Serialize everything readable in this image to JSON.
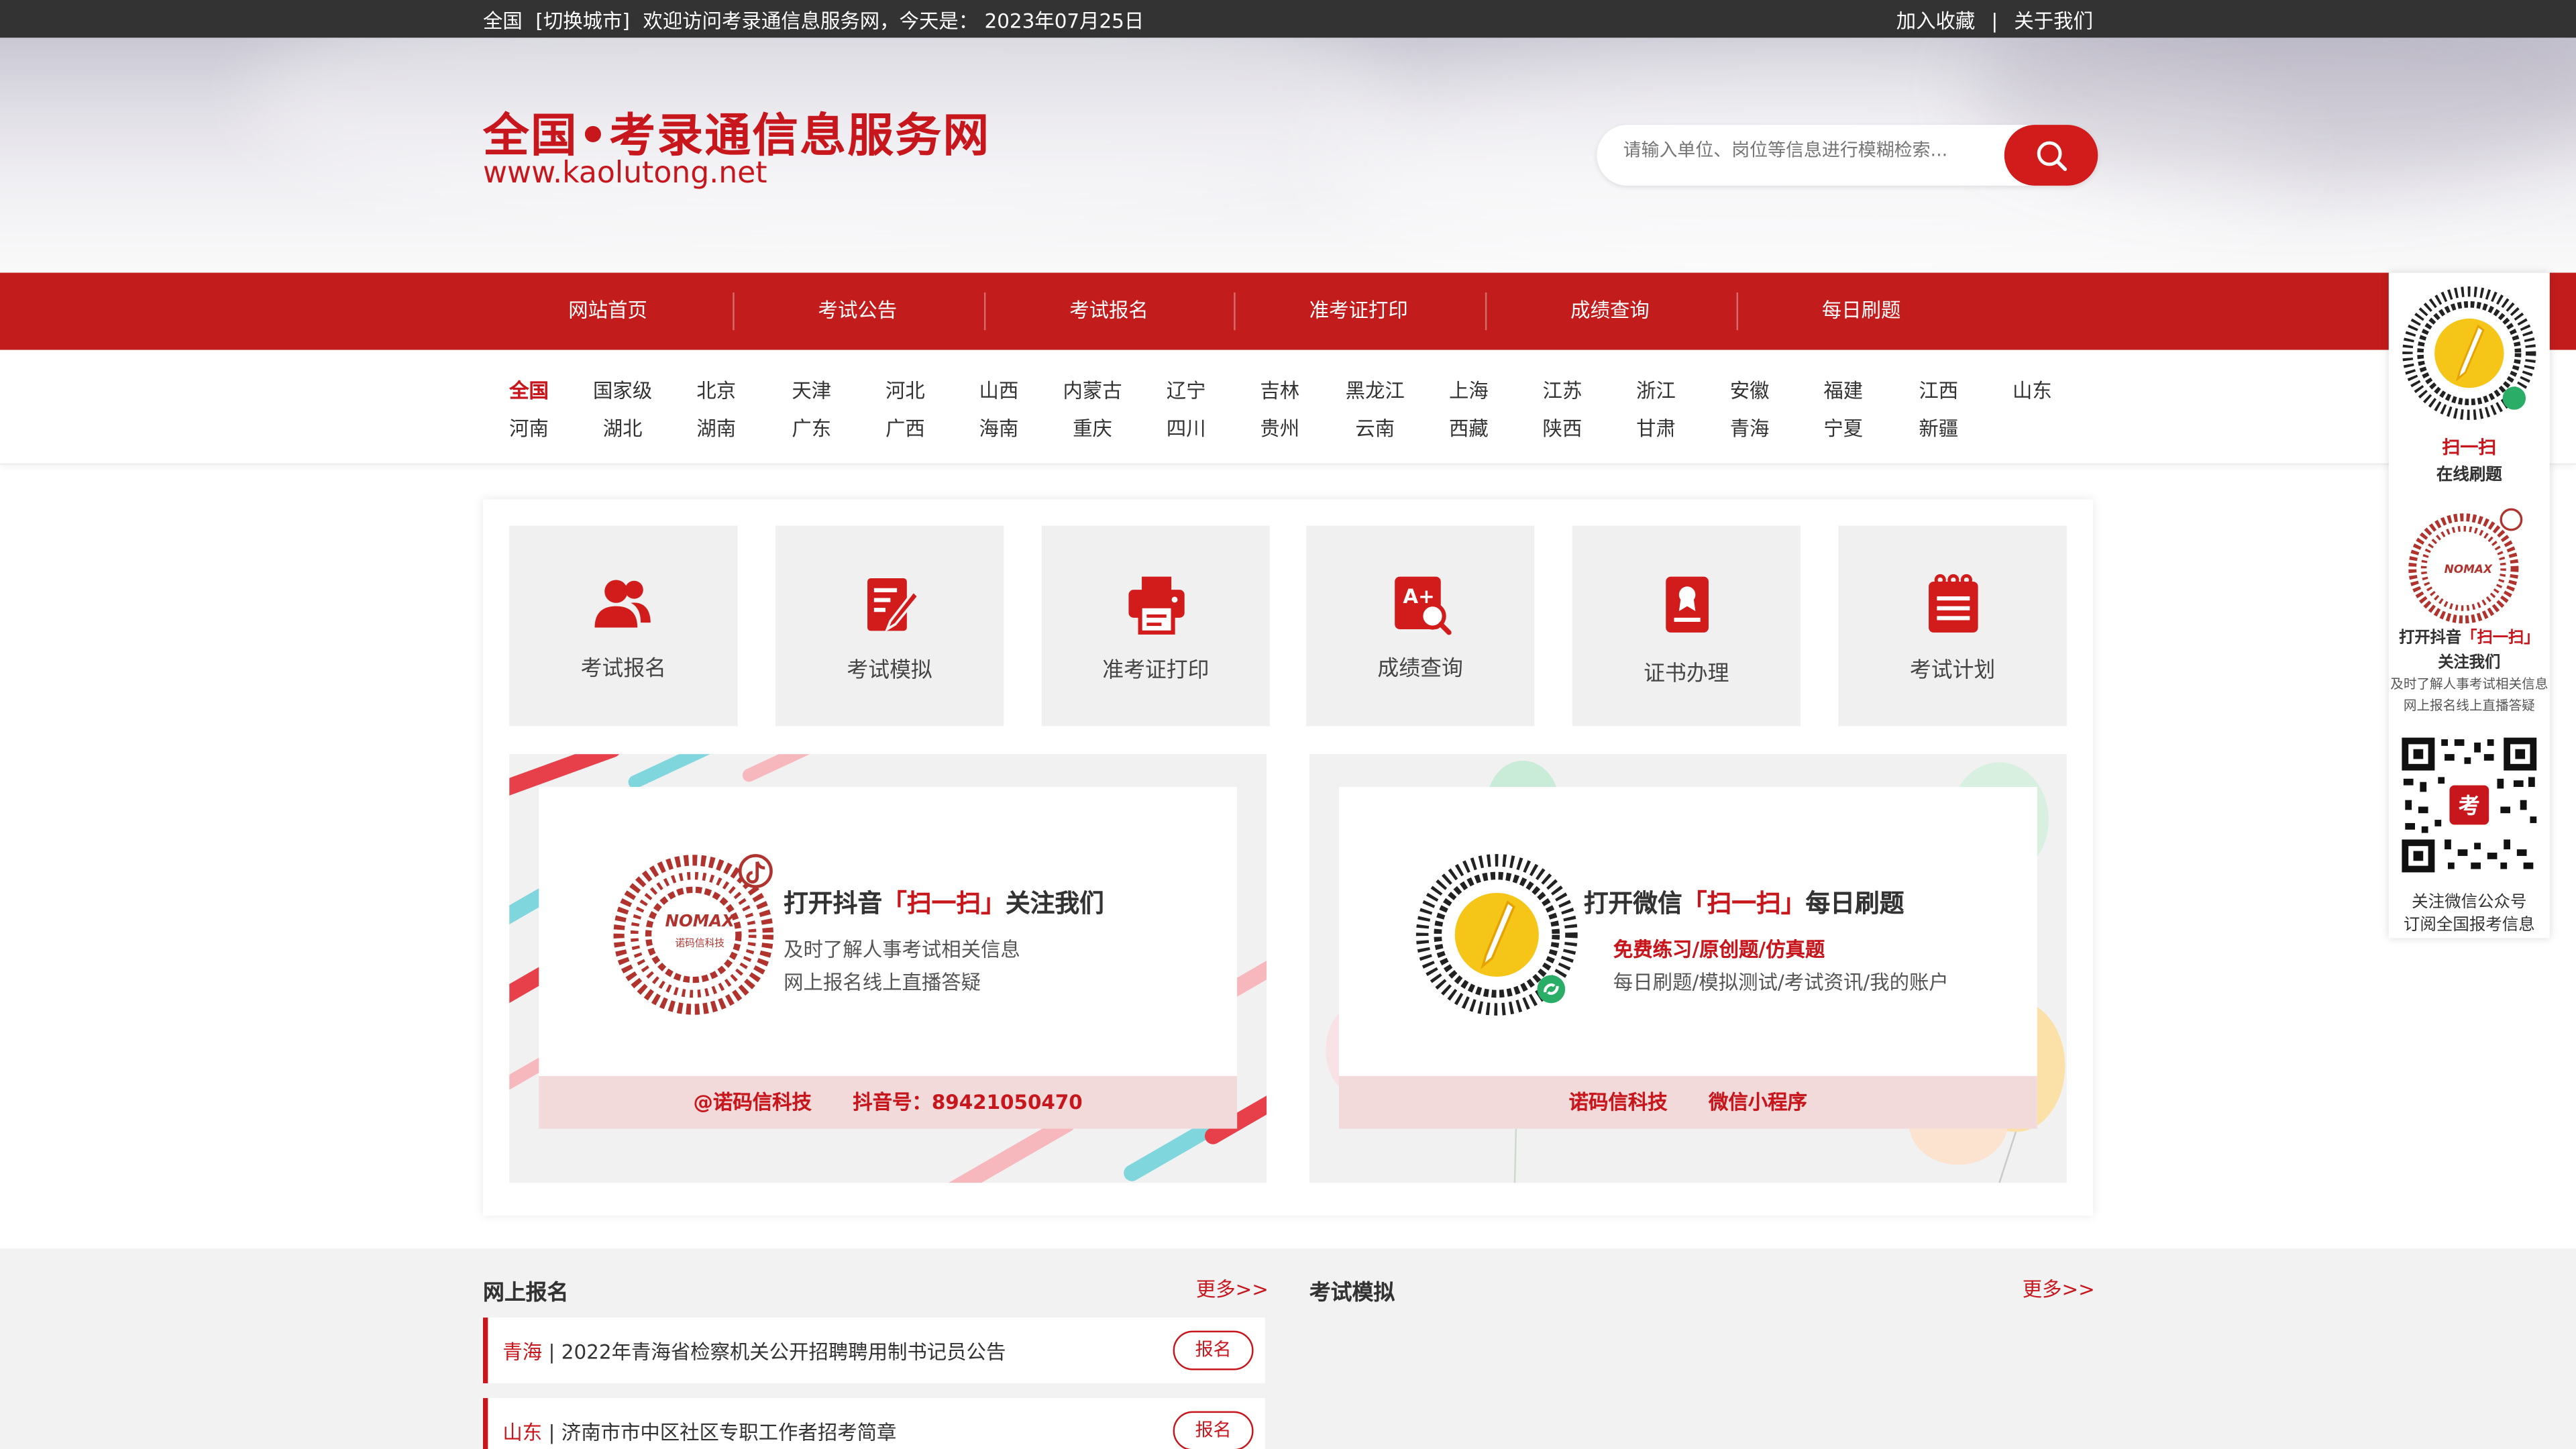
{
  "topbar": {
    "region": "全国",
    "switch_city": "[切换城市]",
    "welcome": "欢迎访问考录通信息服务网，今天是：",
    "date": "2023年07月25日",
    "favorite": "加入收藏",
    "separator": "|",
    "about": "关于我们"
  },
  "header": {
    "site_title": "全国•考录通信息服务网",
    "site_url": "www.kaolutong.net",
    "search_placeholder": "请输入单位、岗位等信息进行模糊检索..."
  },
  "nav": {
    "items": [
      "网站首页",
      "考试公告",
      "考试报名",
      "准考证打印",
      "成绩查询",
      "每日刷题"
    ]
  },
  "provinces": {
    "row1": [
      "全国",
      "国家级",
      "北京",
      "天津",
      "河北",
      "山西",
      "内蒙古",
      "辽宁",
      "吉林",
      "黑龙江",
      "上海",
      "江苏",
      "浙江",
      "安徽",
      "福建",
      "江西",
      "山东"
    ],
    "row2": [
      "河南",
      "湖北",
      "湖南",
      "广东",
      "广西",
      "海南",
      "重庆",
      "四川",
      "贵州",
      "云南",
      "西藏",
      "陕西",
      "甘肃",
      "青海",
      "宁夏",
      "新疆"
    ]
  },
  "tiles": [
    {
      "label": "考试报名",
      "icon": "users-icon"
    },
    {
      "label": "考试模拟",
      "icon": "edit-doc-icon"
    },
    {
      "label": "准考证打印",
      "icon": "printer-icon"
    },
    {
      "label": "成绩查询",
      "icon": "score-search-icon"
    },
    {
      "label": "证书办理",
      "icon": "certificate-icon"
    },
    {
      "label": "考试计划",
      "icon": "plan-list-icon"
    }
  ],
  "banners": {
    "douyin": {
      "title_pre": "打开抖音",
      "title_em": "「扫一扫」",
      "title_post": "关注我们",
      "line1": "及时了解人事考试相关信息",
      "line2": "网上报名线上直播答疑",
      "footer": "@诺码信科技      抖音号：89421050470",
      "qr_text": "NOMAX",
      "qr_sub": "诺码信科技"
    },
    "wechat": {
      "title_pre": "打开微信",
      "title_em": "「扫一扫」",
      "title_post": "每日刷题",
      "line1": "免费练习/原创题/仿真题",
      "line2": "每日刷题/模拟测试/考试资讯/我的账户",
      "footer": "诺码信科技      微信小程序"
    }
  },
  "sections": {
    "online_signup": {
      "title": "网上报名",
      "more": "更多>>",
      "rows": [
        {
          "province": "青海",
          "text": "2022年青海省检察机关公开招聘聘用制书记员公告",
          "button": "报名"
        },
        {
          "province": "山东",
          "text": "济南市市中区社区专职工作者招考简章",
          "button": "报名"
        }
      ]
    },
    "exam_sim": {
      "title": "考试模拟",
      "more": "更多>>"
    }
  },
  "side_panel": {
    "block1_title1": "扫一扫",
    "block1_title2": "在线刷题",
    "block2_title_pre": "打开抖音",
    "block2_title_em": "「扫一扫」",
    "block2_title2": "关注我们",
    "block2_line1": "及时了解人事考试相关信息",
    "block2_line2": "网上报名线上直播答疑",
    "block3_line1": "关注微信公众号",
    "block3_line2": "订阅全国报考信息",
    "qr_badge": "考"
  },
  "colors": {
    "brand_red": "#c8161d",
    "nav_red": "#c21c1c",
    "topbar": "#333333"
  }
}
